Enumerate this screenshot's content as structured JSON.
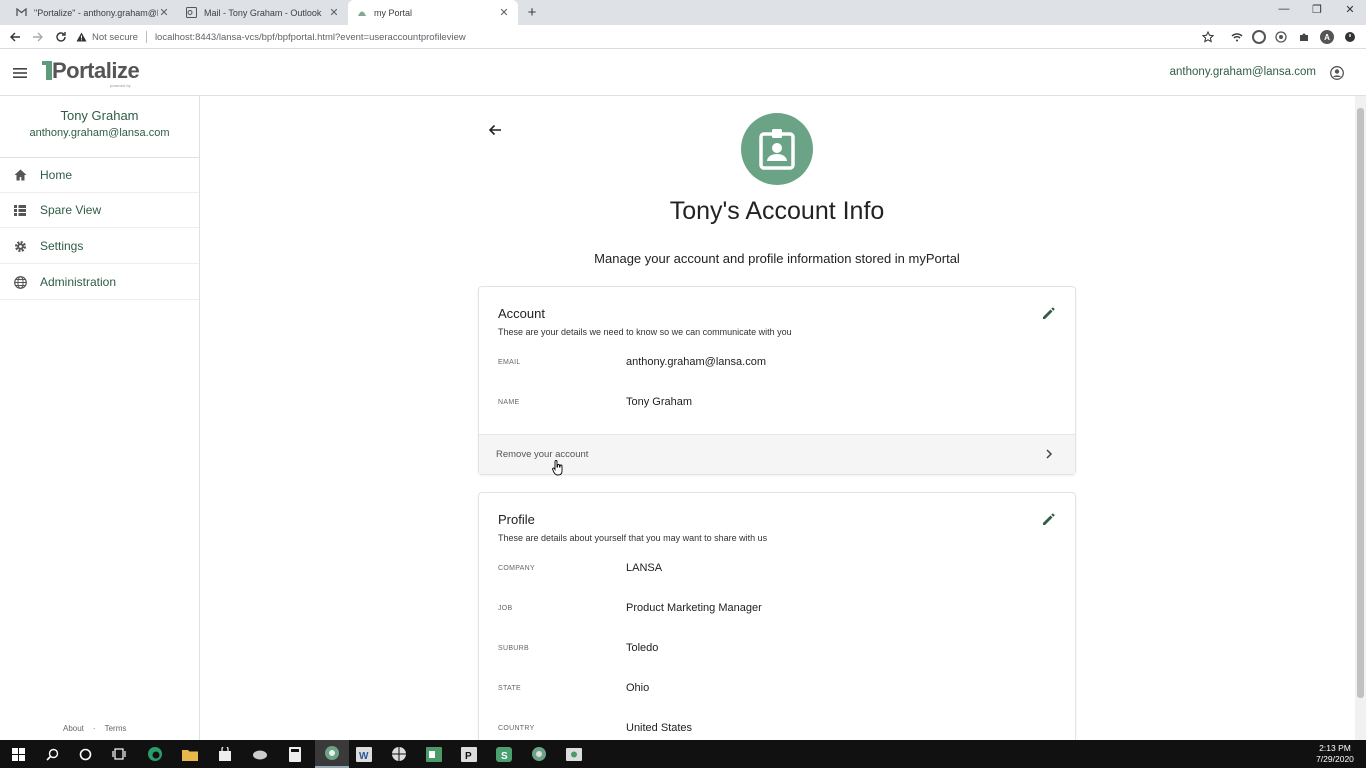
{
  "browser": {
    "tabs": [
      {
        "title": "\"Portalize\" - anthony.graham@la",
        "active": false
      },
      {
        "title": "Mail - Tony Graham - Outlook",
        "active": false
      },
      {
        "title": "my Portal",
        "active": true
      }
    ],
    "security_label": "Not secure",
    "url": "localhost:8443/lansa-vcs/bpf/bpfportal.html?event=useraccountprofileview"
  },
  "header": {
    "logo_text": "Portalize",
    "logo_tagline": "powered by",
    "user_email": "anthony.graham@lansa.com"
  },
  "sidebar": {
    "user_name": "Tony Graham",
    "user_email": "anthony.graham@lansa.com",
    "items": [
      {
        "label": "Home",
        "icon": "home-icon"
      },
      {
        "label": "Spare View",
        "icon": "grid-icon"
      },
      {
        "label": "Settings",
        "icon": "gear-icon"
      },
      {
        "label": "Administration",
        "icon": "globe-icon"
      }
    ],
    "footer_links": [
      "About",
      "Terms"
    ]
  },
  "main": {
    "title": "Tony's Account Info",
    "subtitle": "Manage your account and profile information stored in myPortal",
    "account": {
      "title": "Account",
      "description": "These are your details we need to know so we can communicate with you",
      "fields": [
        {
          "label": "EMAIL",
          "value": "anthony.graham@lansa.com"
        },
        {
          "label": "NAME",
          "value": "Tony Graham"
        }
      ],
      "remove_label": "Remove your account"
    },
    "profile": {
      "title": "Profile",
      "description": "These are details about yourself that you may want to share with us",
      "fields": [
        {
          "label": "COMPANY",
          "value": "LANSA"
        },
        {
          "label": "JOB",
          "value": "Product Marketing Manager"
        },
        {
          "label": "SUBURB",
          "value": "Toledo"
        },
        {
          "label": "STATE",
          "value": "Ohio"
        },
        {
          "label": "COUNTRY",
          "value": "United States"
        }
      ]
    }
  },
  "taskbar": {
    "time": "2:13 PM",
    "date": "7/29/2020"
  },
  "colors": {
    "brand_green": "#5e9a7c",
    "nav_green": "#2f5d46",
    "avatar_bg": "#6aa386"
  }
}
